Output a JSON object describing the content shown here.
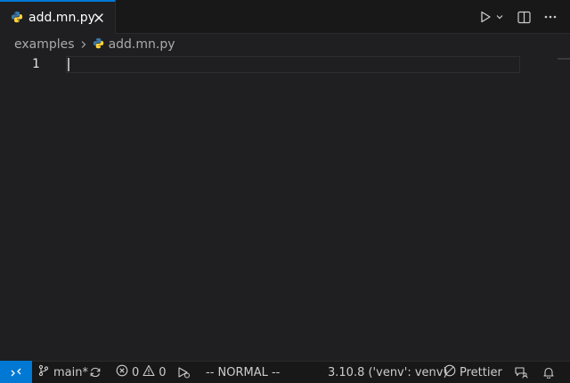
{
  "tab": {
    "filename": "add.mn.py"
  },
  "breadcrumb": {
    "folder": "examples",
    "file": "add.mn.py"
  },
  "editor": {
    "line_numbers": [
      "1"
    ]
  },
  "statusbar": {
    "branch": "main*",
    "errors": "0",
    "warnings": "0",
    "vim_mode": "-- NORMAL --",
    "interpreter": "3.10.8 ('venv': venv)",
    "formatter": "Prettier"
  },
  "colors": {
    "accent": "#0078d4",
    "background": "#1f1f21",
    "chrome": "#181818",
    "python_blue": "#3c78aa",
    "python_yellow": "#ffd43b"
  },
  "icons": [
    "python-icon",
    "close-icon",
    "run-icon",
    "chevron-down-icon",
    "split-editor-icon",
    "more-icon",
    "chevron-right-icon",
    "remote-icon",
    "git-branch-icon",
    "sync-icon",
    "error-icon",
    "warning-icon",
    "debug-icon",
    "prettier-icon",
    "feedback-icon",
    "bell-icon"
  ]
}
